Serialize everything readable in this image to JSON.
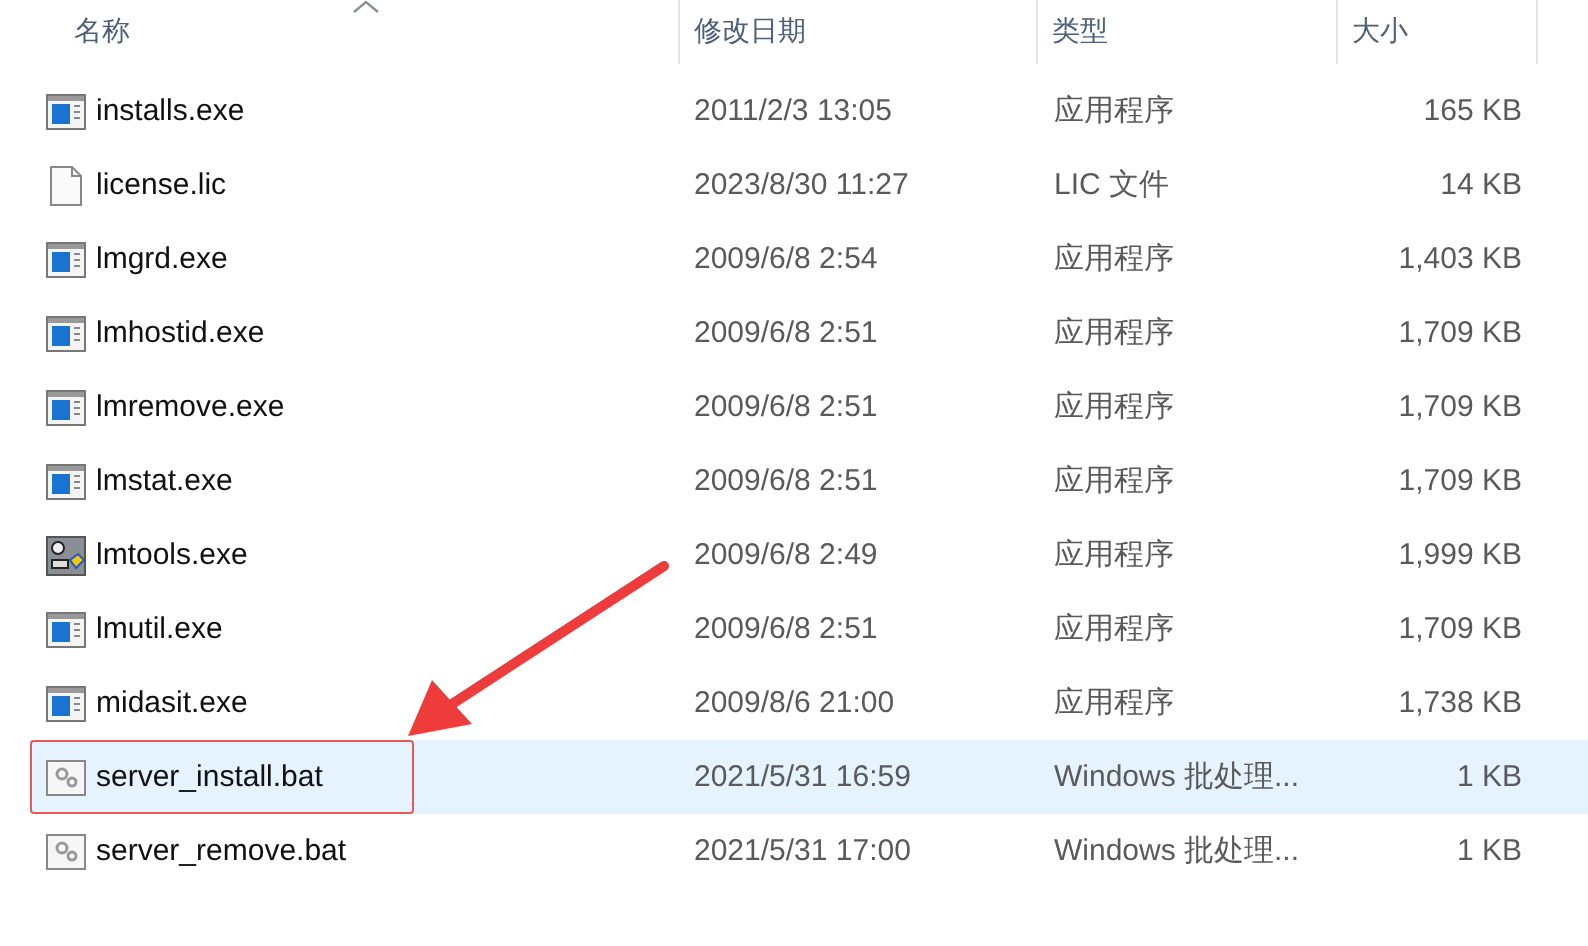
{
  "columns": [
    {
      "label": "名称",
      "sorted": true
    },
    {
      "label": "修改日期",
      "sorted": false
    },
    {
      "label": "类型",
      "sorted": false
    },
    {
      "label": "大小",
      "sorted": false
    }
  ],
  "files": [
    {
      "kind": "exe",
      "name": "installs.exe",
      "date": "2011/2/3 13:05",
      "type": "应用程序",
      "size": "165 KB",
      "selected": false,
      "annotated": false
    },
    {
      "kind": "file",
      "name": "license.lic",
      "date": "2023/8/30 11:27",
      "type": "LIC 文件",
      "size": "14 KB",
      "selected": false,
      "annotated": false
    },
    {
      "kind": "exe",
      "name": "lmgrd.exe",
      "date": "2009/6/8 2:54",
      "type": "应用程序",
      "size": "1,403 KB",
      "selected": false,
      "annotated": false
    },
    {
      "kind": "exe",
      "name": "lmhostid.exe",
      "date": "2009/6/8 2:51",
      "type": "应用程序",
      "size": "1,709 KB",
      "selected": false,
      "annotated": false
    },
    {
      "kind": "exe",
      "name": "lmremove.exe",
      "date": "2009/6/8 2:51",
      "type": "应用程序",
      "size": "1,709 KB",
      "selected": false,
      "annotated": false
    },
    {
      "kind": "exe",
      "name": "lmstat.exe",
      "date": "2009/6/8 2:51",
      "type": "应用程序",
      "size": "1,709 KB",
      "selected": false,
      "annotated": false
    },
    {
      "kind": "tool",
      "name": "lmtools.exe",
      "date": "2009/6/8 2:49",
      "type": "应用程序",
      "size": "1,999 KB",
      "selected": false,
      "annotated": false
    },
    {
      "kind": "exe",
      "name": "lmutil.exe",
      "date": "2009/6/8 2:51",
      "type": "应用程序",
      "size": "1,709 KB",
      "selected": false,
      "annotated": false
    },
    {
      "kind": "exe",
      "name": "midasit.exe",
      "date": "2009/8/6 21:00",
      "type": "应用程序",
      "size": "1,738 KB",
      "selected": false,
      "annotated": false
    },
    {
      "kind": "bat",
      "name": "server_install.bat",
      "date": "2021/5/31 16:59",
      "type": "Windows 批处理...",
      "size": "1 KB",
      "selected": true,
      "annotated": true
    },
    {
      "kind": "bat",
      "name": "server_remove.bat",
      "date": "2021/5/31 17:00",
      "type": "Windows 批处理...",
      "size": "1 KB",
      "selected": false,
      "annotated": false
    }
  ]
}
